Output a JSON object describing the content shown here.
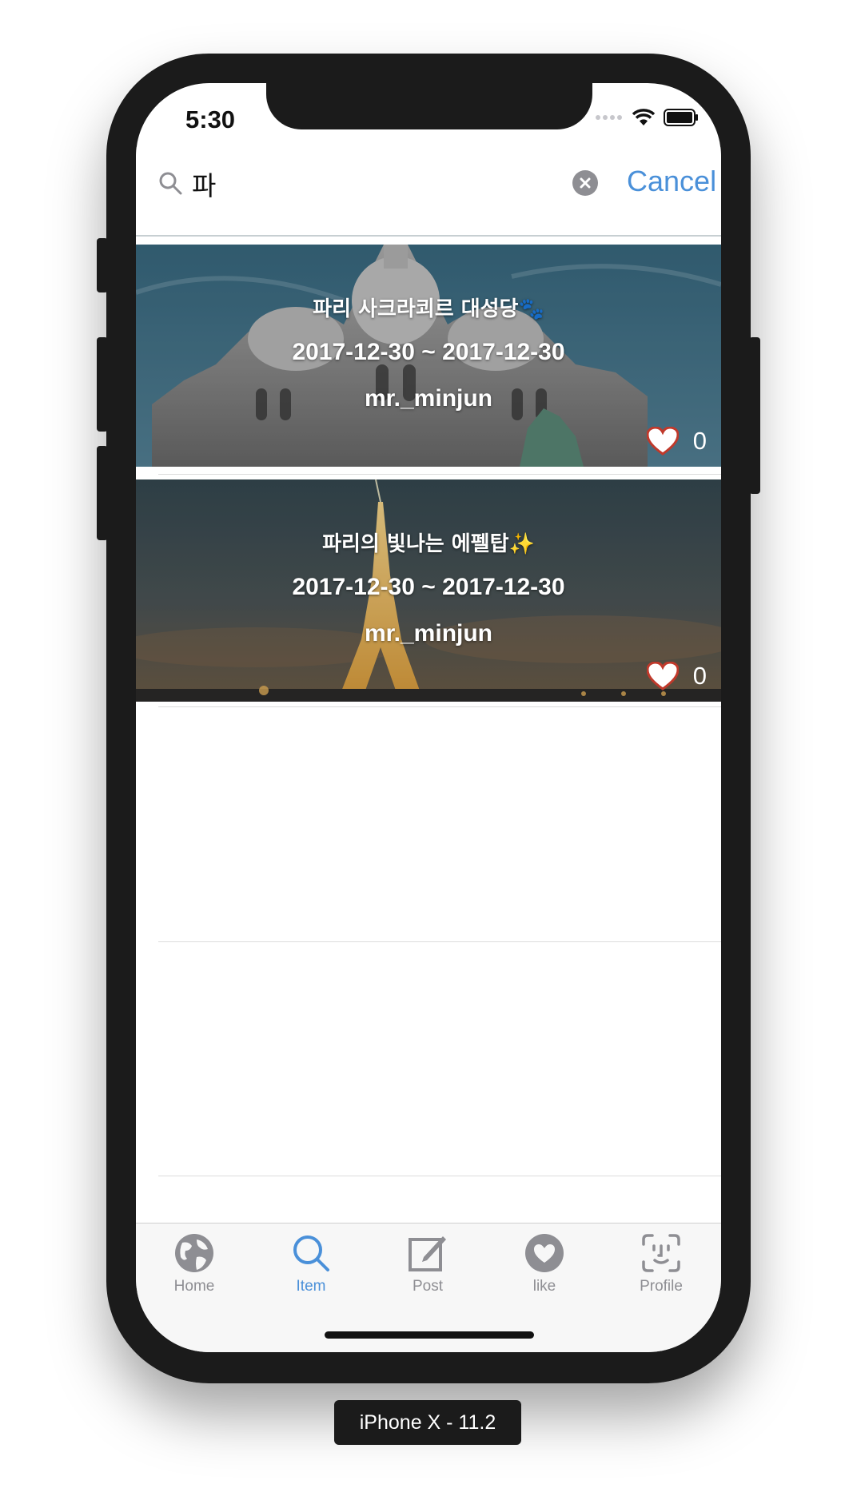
{
  "status_bar": {
    "time": "5:30"
  },
  "search": {
    "query": "파",
    "cancel_label": "Cancel"
  },
  "results": [
    {
      "title": "파리 사크라쾨르 대성당🐾",
      "dates": "2017-12-30 ~ 2017-12-30",
      "user": "mr._minjun",
      "likes": "0"
    },
    {
      "title": "파리의 빛나는 에펠탑✨",
      "dates": "2017-12-30 ~ 2017-12-30",
      "user": "mr._minjun",
      "likes": "0"
    }
  ],
  "tabbar": {
    "items": [
      {
        "label": "Home",
        "icon": "globe-icon"
      },
      {
        "label": "Item",
        "icon": "search-icon"
      },
      {
        "label": "Post",
        "icon": "compose-icon"
      },
      {
        "label": "like",
        "icon": "heart-icon"
      },
      {
        "label": "Profile",
        "icon": "face-id-icon"
      }
    ],
    "active": "Item"
  },
  "device_label": "iPhone X - 11.2",
  "colors": {
    "accent": "#4a90d9",
    "heart": "#c0392b",
    "device": "#1b1b1b"
  }
}
